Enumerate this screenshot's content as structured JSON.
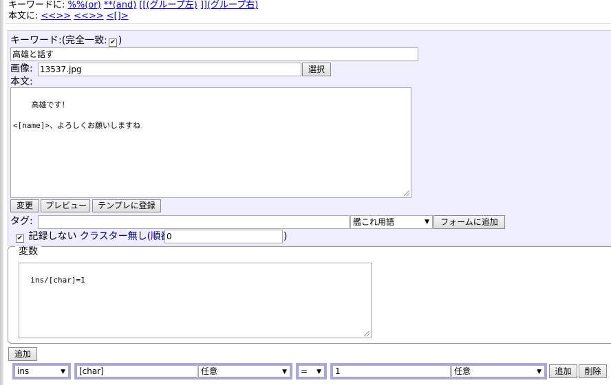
{
  "toolbar": {
    "keyword_prefix": "キーワードに:",
    "keyword_links": [
      "%%(or)",
      "**(and)",
      "[[(グループ左)",
      "]](グループ右)"
    ],
    "body_prefix": "本文に:",
    "body_links": [
      "<<>>",
      "<<>>",
      "<[]>"
    ]
  },
  "form": {
    "keyword_label": "キーワード:(完全一致:",
    "keyword_checkbox_checked": true,
    "keyword_label_close": ")",
    "keyword_value": "高雄と話す",
    "image_label": "画像:",
    "image_value": "13537.jpg",
    "select_button": "選択",
    "body_label": "本文:",
    "body_value": "高雄です！\n\n<[name]>、よろしくお願いしますね",
    "change_button": "変更",
    "preview_button": "プレビュー",
    "register_template_button": "テンプレに登録",
    "tag_label": "タグ:",
    "tag_value": "",
    "tag_select": "艦これ用語",
    "add_to_form_button": "フォームに追加",
    "no_record_checked": true,
    "no_record_label": "記録しない",
    "no_cluster_label": "クラスター無し(順番",
    "order_value": "0",
    "order_close": ")"
  },
  "variables": {
    "legend": "変数",
    "value": "ins/[char]=1"
  },
  "add_button": "追加",
  "condition_row": {
    "var_select": "ins",
    "char_value": "[char]",
    "char_select": "任意",
    "op_select": "=",
    "num_value": "1",
    "num_select": "任意",
    "add_button": "追加",
    "delete_button": "削除"
  },
  "colors": {
    "panel_bg": "#eeeeff",
    "link": "#0000cc",
    "select_outline": "#a8a8e0"
  }
}
